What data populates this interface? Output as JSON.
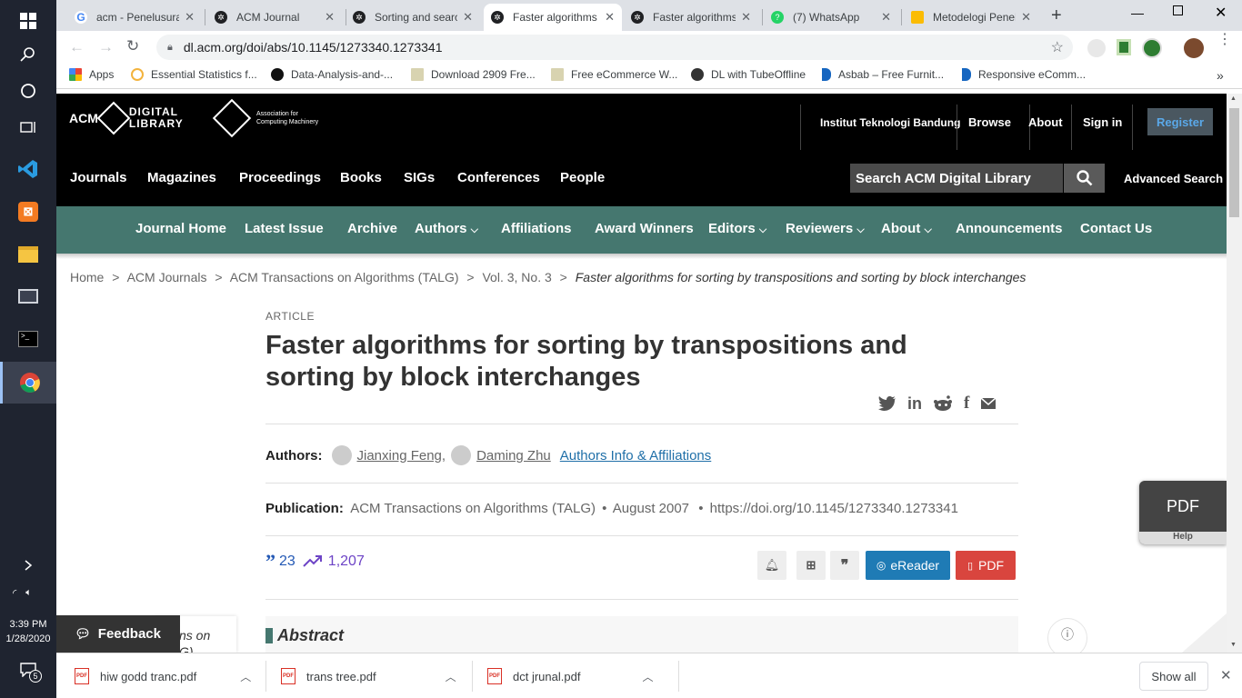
{
  "taskbar": {
    "time": "3:39 PM",
    "date": "1/28/2020",
    "notif_count": "5"
  },
  "browser": {
    "tabs": [
      {
        "title": "acm - Penelusuran"
      },
      {
        "title": "ACM Journal"
      },
      {
        "title": "Sorting and search"
      },
      {
        "title": "Faster algorithms"
      },
      {
        "title": "Faster algorithms"
      },
      {
        "title": "(7) WhatsApp"
      },
      {
        "title": "Metodelogi Penelitian"
      }
    ],
    "url": "dl.acm.org/doi/abs/10.1145/1273340.1273341",
    "bookmarks": [
      {
        "label": "Apps"
      },
      {
        "label": "Essential Statistics f..."
      },
      {
        "label": "Data-Analysis-and-..."
      },
      {
        "label": "Download 2909 Fre..."
      },
      {
        "label": "Free eCommerce W..."
      },
      {
        "label": "DL with TubeOffline"
      },
      {
        "label": "Asbab – Free Furnit..."
      },
      {
        "label": "Responsive eComm..."
      }
    ]
  },
  "acm": {
    "logo_acm": "ACM",
    "logo_digital": "DIGITAL",
    "logo_library": "LIBRARY",
    "assoc_line1": "Association for",
    "assoc_line2": "Computing Machinery",
    "institution": "Institut Teknologi Bandung",
    "browse": "Browse",
    "about": "About",
    "signin": "Sign in",
    "register": "Register",
    "nav": [
      "Journals",
      "Magazines",
      "Proceedings",
      "Books",
      "SIGs",
      "Conferences",
      "People"
    ],
    "search_placeholder": "Search ACM Digital Library",
    "advanced_search": "Advanced Search",
    "journal_nav": [
      "Journal Home",
      "Latest Issue",
      "Archive",
      "Authors",
      "Affiliations",
      "Award Winners",
      "Editors",
      "Reviewers",
      "About",
      "Announcements",
      "Contact Us"
    ]
  },
  "breadcrumb": {
    "items": [
      "Home",
      "ACM Journals",
      "ACM Transactions on Algorithms (TALG)",
      "Vol. 3, No. 3"
    ],
    "current": "Faster algorithms for sorting by transpositions and sorting by block interchanges",
    "sep": ">"
  },
  "article": {
    "type": "ARTICLE",
    "title_line1": "Faster algorithms for sorting by transpositions and",
    "title_line2": "sorting by block interchanges",
    "authors_label": "Authors:",
    "authors": [
      "Jianxing Feng,",
      "Daming Zhu"
    ],
    "authors_info": "Authors Info & Affiliations",
    "publication_label": "Publication:",
    "journal": "ACM Transactions on Algorithms (TALG)",
    "date": "August 2007",
    "doi": "https://doi.org/10.1145/1273340.1273341",
    "citations": "23",
    "downloads": "1,207",
    "ereader": "eReader",
    "pdf": "PDF",
    "abstract": "Abstract",
    "sidebar_partial_1": "ns on",
    "sidebar_partial_2": "G)"
  },
  "pdf_widget": {
    "label": "PDF",
    "help": "Help"
  },
  "feedback": "Feedback",
  "downloads_bar": {
    "files": [
      "hiw godd tranc.pdf",
      "trans tree.pdf",
      "dct  jrunal.pdf"
    ],
    "show_all": "Show all"
  },
  "colors": {
    "teal": "#45776f",
    "register": "#4a5760",
    "ereader": "#1f7bb5",
    "pdf": "#d9453e",
    "cite": "#2459b5",
    "trend": "#6d44c6"
  }
}
